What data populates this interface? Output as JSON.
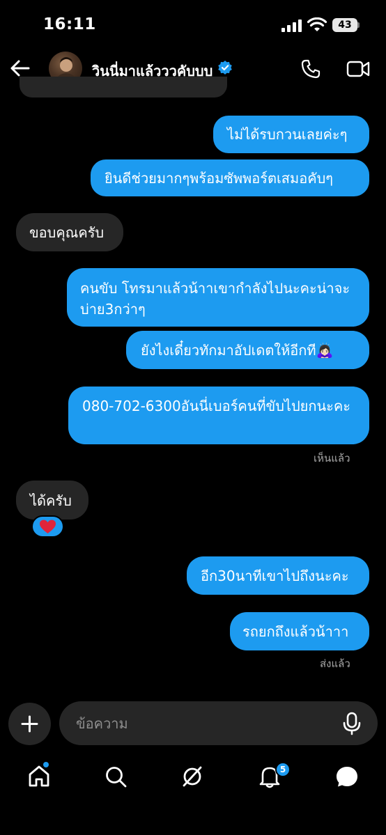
{
  "status_bar": {
    "time": "16:11",
    "battery": "43"
  },
  "header": {
    "contact_name": "วินนี่มาแล้วววคับบบ"
  },
  "messages": [
    {
      "direction": "out",
      "text": "ไม่ได้รบกวนเลยค่ะๆ"
    },
    {
      "direction": "out",
      "text": "ยินดีช่วยมากๆพร้อมซัพพอร์ตเสมอคับๆ"
    },
    {
      "direction": "in",
      "text": "ขอบคุณครับ"
    },
    {
      "direction": "out",
      "text": "คนขับ โทรมาแล้วน้าาเขากำลังไปนะคะน่าจะบ่าย3กว่าๆ"
    },
    {
      "direction": "out",
      "text": "ยังไงเดี๋ยวทักมาอัปเดตให้อีกที🙇🏻‍♀️"
    },
    {
      "direction": "out",
      "text": "080-702-6300อันนี่เบอร์คนที่ขับไปยกนะคะ"
    },
    {
      "direction": "in",
      "text": "ได้ครับ",
      "reaction": "❤️"
    },
    {
      "direction": "out",
      "text": "อีก30นาทีเขาไปถึงนะคะ"
    },
    {
      "direction": "out",
      "text": "รถยกถึงแล้วน้าาา"
    }
  ],
  "receipts": {
    "seen": "เห็นแล้ว",
    "sent": "ส่งแล้ว"
  },
  "composer": {
    "placeholder": "ข้อความ"
  },
  "nav": {
    "notification_count": "5"
  },
  "colors": {
    "accent": "#1d9bf0",
    "incoming_bubble": "#262626",
    "background": "#000000"
  }
}
